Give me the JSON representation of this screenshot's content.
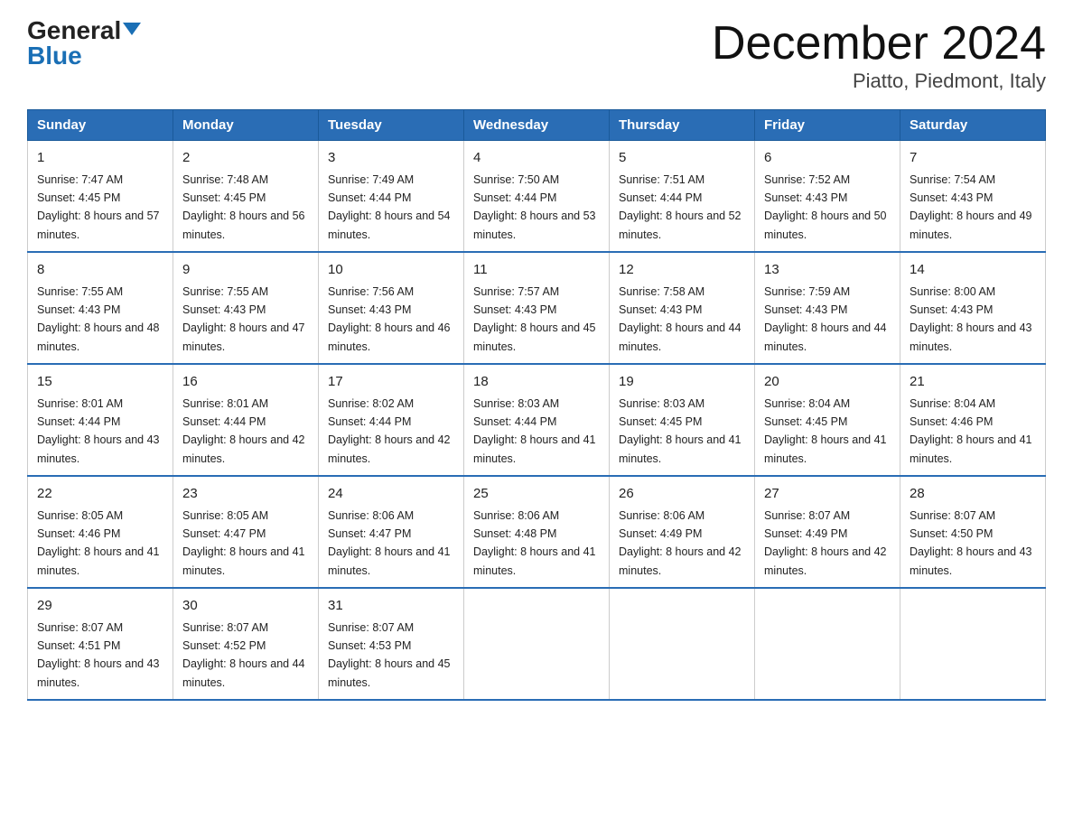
{
  "header": {
    "logo_general": "General",
    "logo_blue": "Blue",
    "title": "December 2024",
    "subtitle": "Piatto, Piedmont, Italy"
  },
  "days_of_week": [
    "Sunday",
    "Monday",
    "Tuesday",
    "Wednesday",
    "Thursday",
    "Friday",
    "Saturday"
  ],
  "weeks": [
    [
      {
        "day": "1",
        "sunrise": "7:47 AM",
        "sunset": "4:45 PM",
        "daylight": "8 hours and 57 minutes."
      },
      {
        "day": "2",
        "sunrise": "7:48 AM",
        "sunset": "4:45 PM",
        "daylight": "8 hours and 56 minutes."
      },
      {
        "day": "3",
        "sunrise": "7:49 AM",
        "sunset": "4:44 PM",
        "daylight": "8 hours and 54 minutes."
      },
      {
        "day": "4",
        "sunrise": "7:50 AM",
        "sunset": "4:44 PM",
        "daylight": "8 hours and 53 minutes."
      },
      {
        "day": "5",
        "sunrise": "7:51 AM",
        "sunset": "4:44 PM",
        "daylight": "8 hours and 52 minutes."
      },
      {
        "day": "6",
        "sunrise": "7:52 AM",
        "sunset": "4:43 PM",
        "daylight": "8 hours and 50 minutes."
      },
      {
        "day": "7",
        "sunrise": "7:54 AM",
        "sunset": "4:43 PM",
        "daylight": "8 hours and 49 minutes."
      }
    ],
    [
      {
        "day": "8",
        "sunrise": "7:55 AM",
        "sunset": "4:43 PM",
        "daylight": "8 hours and 48 minutes."
      },
      {
        "day": "9",
        "sunrise": "7:55 AM",
        "sunset": "4:43 PM",
        "daylight": "8 hours and 47 minutes."
      },
      {
        "day": "10",
        "sunrise": "7:56 AM",
        "sunset": "4:43 PM",
        "daylight": "8 hours and 46 minutes."
      },
      {
        "day": "11",
        "sunrise": "7:57 AM",
        "sunset": "4:43 PM",
        "daylight": "8 hours and 45 minutes."
      },
      {
        "day": "12",
        "sunrise": "7:58 AM",
        "sunset": "4:43 PM",
        "daylight": "8 hours and 44 minutes."
      },
      {
        "day": "13",
        "sunrise": "7:59 AM",
        "sunset": "4:43 PM",
        "daylight": "8 hours and 44 minutes."
      },
      {
        "day": "14",
        "sunrise": "8:00 AM",
        "sunset": "4:43 PM",
        "daylight": "8 hours and 43 minutes."
      }
    ],
    [
      {
        "day": "15",
        "sunrise": "8:01 AM",
        "sunset": "4:44 PM",
        "daylight": "8 hours and 43 minutes."
      },
      {
        "day": "16",
        "sunrise": "8:01 AM",
        "sunset": "4:44 PM",
        "daylight": "8 hours and 42 minutes."
      },
      {
        "day": "17",
        "sunrise": "8:02 AM",
        "sunset": "4:44 PM",
        "daylight": "8 hours and 42 minutes."
      },
      {
        "day": "18",
        "sunrise": "8:03 AM",
        "sunset": "4:44 PM",
        "daylight": "8 hours and 41 minutes."
      },
      {
        "day": "19",
        "sunrise": "8:03 AM",
        "sunset": "4:45 PM",
        "daylight": "8 hours and 41 minutes."
      },
      {
        "day": "20",
        "sunrise": "8:04 AM",
        "sunset": "4:45 PM",
        "daylight": "8 hours and 41 minutes."
      },
      {
        "day": "21",
        "sunrise": "8:04 AM",
        "sunset": "4:46 PM",
        "daylight": "8 hours and 41 minutes."
      }
    ],
    [
      {
        "day": "22",
        "sunrise": "8:05 AM",
        "sunset": "4:46 PM",
        "daylight": "8 hours and 41 minutes."
      },
      {
        "day": "23",
        "sunrise": "8:05 AM",
        "sunset": "4:47 PM",
        "daylight": "8 hours and 41 minutes."
      },
      {
        "day": "24",
        "sunrise": "8:06 AM",
        "sunset": "4:47 PM",
        "daylight": "8 hours and 41 minutes."
      },
      {
        "day": "25",
        "sunrise": "8:06 AM",
        "sunset": "4:48 PM",
        "daylight": "8 hours and 41 minutes."
      },
      {
        "day": "26",
        "sunrise": "8:06 AM",
        "sunset": "4:49 PM",
        "daylight": "8 hours and 42 minutes."
      },
      {
        "day": "27",
        "sunrise": "8:07 AM",
        "sunset": "4:49 PM",
        "daylight": "8 hours and 42 minutes."
      },
      {
        "day": "28",
        "sunrise": "8:07 AM",
        "sunset": "4:50 PM",
        "daylight": "8 hours and 43 minutes."
      }
    ],
    [
      {
        "day": "29",
        "sunrise": "8:07 AM",
        "sunset": "4:51 PM",
        "daylight": "8 hours and 43 minutes."
      },
      {
        "day": "30",
        "sunrise": "8:07 AM",
        "sunset": "4:52 PM",
        "daylight": "8 hours and 44 minutes."
      },
      {
        "day": "31",
        "sunrise": "8:07 AM",
        "sunset": "4:53 PM",
        "daylight": "8 hours and 45 minutes."
      },
      null,
      null,
      null,
      null
    ]
  ]
}
